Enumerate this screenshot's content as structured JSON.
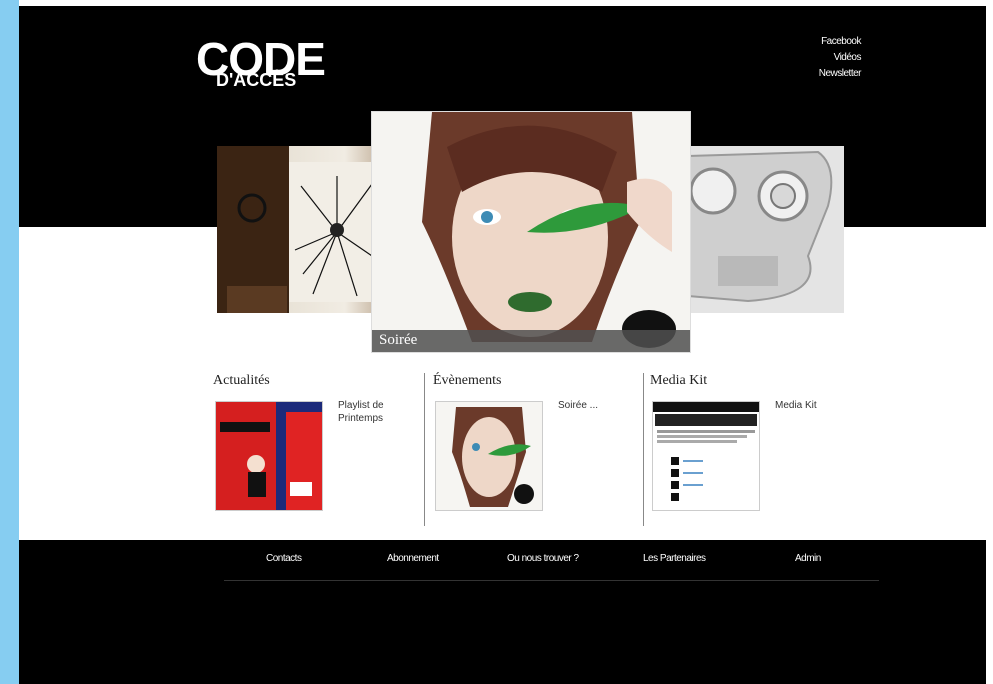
{
  "logo": {
    "line1": "CODE",
    "line2": "D'ACCÈS"
  },
  "top_links": [
    "Facebook",
    "Vidéos",
    "Newsletter"
  ],
  "carousel": {
    "main_caption": "Soirée"
  },
  "sections": [
    {
      "title": "Actualités",
      "caption": "Playlist de Printemps"
    },
    {
      "title": "Évènements",
      "caption": "Soirée ..."
    },
    {
      "title": "Media Kit",
      "caption": "Media Kit"
    }
  ],
  "footer_nav": [
    "Contacts",
    "Abonnement",
    "Ou nous trouver ?",
    "Les Partenaires",
    "Admin"
  ],
  "colors": {
    "left_bar": "#86cdf1",
    "header_bg": "#000000",
    "footer_bg": "#000000"
  }
}
